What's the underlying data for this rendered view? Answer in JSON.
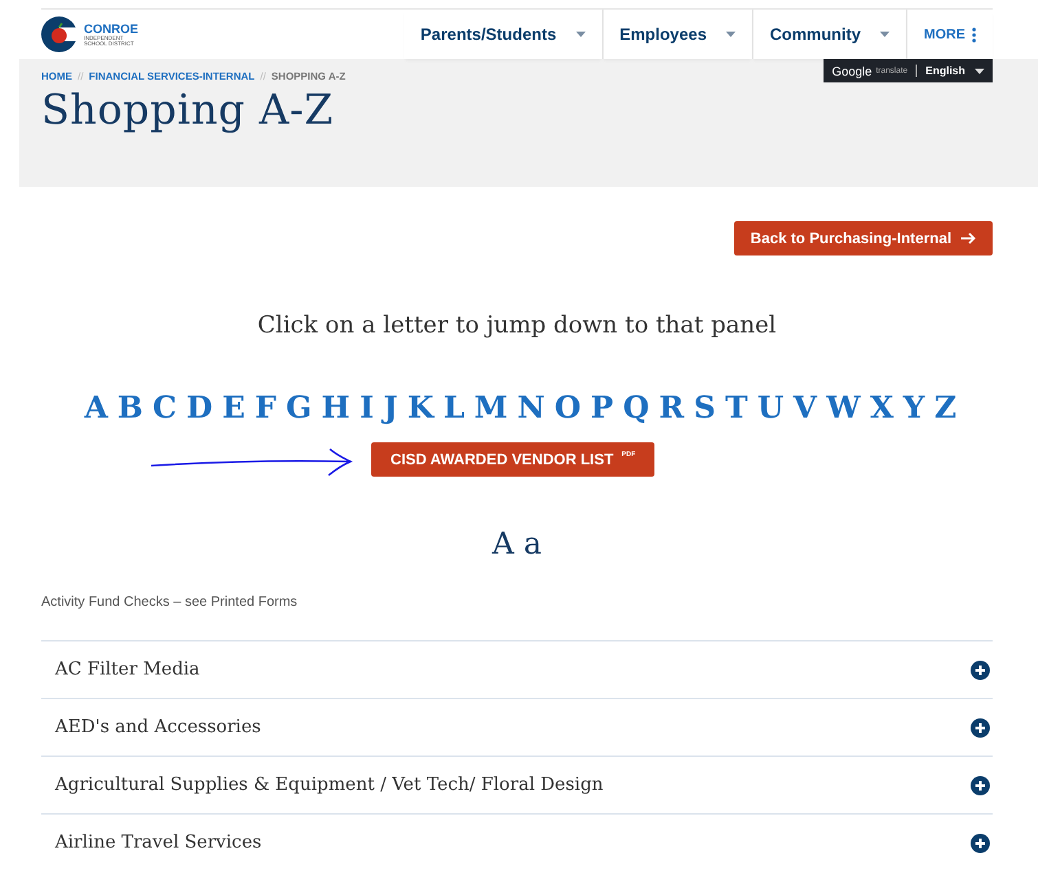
{
  "logo": {
    "name": "CONROE",
    "subtitle_1": "INDEPENDENT",
    "subtitle_2": "SCHOOL DISTRICT"
  },
  "nav": [
    {
      "label": "Parents/Students",
      "kind": "dropdown"
    },
    {
      "label": "Employees",
      "kind": "dropdown"
    },
    {
      "label": "Community",
      "kind": "dropdown"
    },
    {
      "label": "MORE",
      "kind": "more"
    }
  ],
  "breadcrumb_separator": "//",
  "breadcrumbs": [
    {
      "label": "HOME",
      "kind": "link"
    },
    {
      "label": "FINANCIAL SERVICES-INTERNAL",
      "kind": "link"
    },
    {
      "label": "SHOPPING A-Z",
      "kind": "current"
    }
  ],
  "translate": {
    "brand": "Google",
    "service": "translate",
    "language": "English"
  },
  "page_title": "Shopping A-Z",
  "back_button": "Back to Purchasing-Internal",
  "instruction": "Click on a letter to jump down to that panel",
  "letters": [
    "A",
    "B",
    "C",
    "D",
    "E",
    "F",
    "G",
    "H",
    "I",
    "J",
    "K",
    "L",
    "M",
    "N",
    "O",
    "P",
    "Q",
    "R",
    "S",
    "T",
    "U",
    "V",
    "W",
    "X",
    "Y",
    "Z"
  ],
  "vendor_button": {
    "label": "CISD AWARDED VENDOR LIST",
    "tag": "PDF"
  },
  "section_heading": "A a",
  "note": "Activity Fund Checks – see Printed Forms",
  "accordion": [
    {
      "title": "AC Filter Media",
      "expanded": false
    },
    {
      "title": "AED's and Accessories",
      "expanded": false
    },
    {
      "title": "Agricultural Supplies & Equipment / Vet Tech/ Floral Design",
      "expanded": false
    },
    {
      "title": "Airline Travel Services",
      "expanded": false
    }
  ]
}
